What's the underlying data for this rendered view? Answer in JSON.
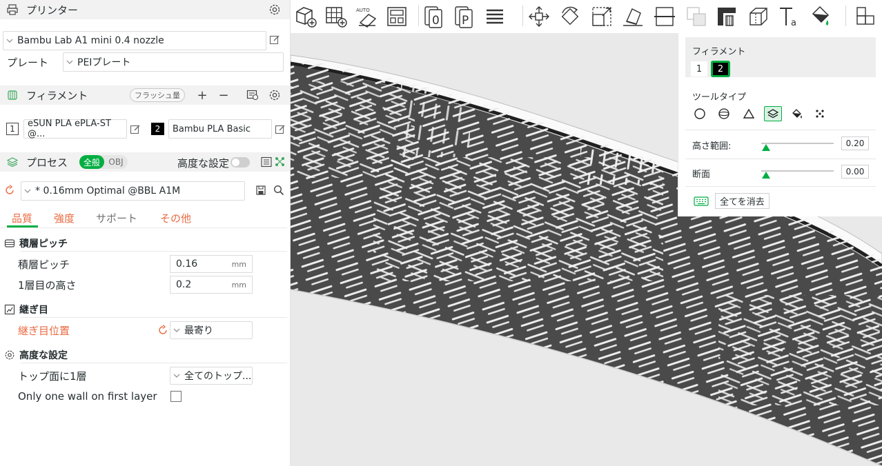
{
  "printer": {
    "title": "プリンター",
    "selected": "Bambu Lab A1 mini 0.4 nozzle",
    "plate_label": "プレート",
    "plate_value": "PEIプレート"
  },
  "filament": {
    "title": "フィラメント",
    "flush_label": "フラッシュ量",
    "items": [
      {
        "num": "1",
        "name": "eSUN PLA ePLA-ST @...",
        "swatch": "#ffffff",
        "text_color": "#262e30"
      },
      {
        "num": "2",
        "name": "Bambu PLA Basic",
        "swatch": "#000000",
        "text_color": "#ffffff"
      }
    ]
  },
  "process": {
    "title": "プロセス",
    "toggle_global": "全般",
    "toggle_obj": "OBJ",
    "advanced_label": "高度な設定",
    "preset": "* 0.16mm Optimal @BBL A1M",
    "tabs": [
      "品質",
      "強度",
      "サポート",
      "その他"
    ],
    "groups": {
      "layer": {
        "title": "積層ピッチ",
        "layer_height_label": "積層ピッチ",
        "layer_height_value": "0.16",
        "first_layer_label": "1層目の高さ",
        "first_layer_value": "0.2",
        "unit": "mm"
      },
      "seam": {
        "title": "継ぎ目",
        "position_label": "継ぎ目位置",
        "position_value": "最寄り"
      },
      "advanced": {
        "title": "高度な設定",
        "top_one_wall_label": "トップ面に1層",
        "top_one_wall_value": "全てのトップ...",
        "one_wall_first_label": "Only one wall on first layer",
        "one_wall_first_checked": false
      }
    }
  },
  "toolbar": {
    "icons": [
      "add-object-icon",
      "add-plate-icon",
      "auto-orient-icon",
      "arrange-icon",
      "split-objects-icon",
      "split-parts-icon",
      "layers-icon",
      "move-icon",
      "rotate-icon",
      "scale-icon",
      "lay-on-face-icon",
      "cut-icon",
      "boolean-icon",
      "support-paint-icon",
      "seam-paint-icon",
      "text-icon",
      "color-paint-icon",
      "assembly-icon"
    ],
    "text_icon_label": "Ta"
  },
  "paint_panel": {
    "filament_label": "フィラメント",
    "filament_buttons": [
      "1",
      "2"
    ],
    "selected_filament": "2",
    "tool_type_label": "ツールタイプ",
    "tools": [
      "circle-tool-icon",
      "sphere-tool-icon",
      "triangle-tool-icon",
      "height-range-tool-icon",
      "fill-tool-icon",
      "gap-fill-tool-icon"
    ],
    "selected_tool": "height-range-tool-icon",
    "height_range_label": "高さ範囲:",
    "height_range_value": "0.20",
    "section_label": "断面",
    "section_value": "0.00",
    "clear_all_label": "全てを消去"
  },
  "colors": {
    "accent": "#00ae42",
    "orange": "#ea6a41",
    "model": "#4a4a4a"
  }
}
